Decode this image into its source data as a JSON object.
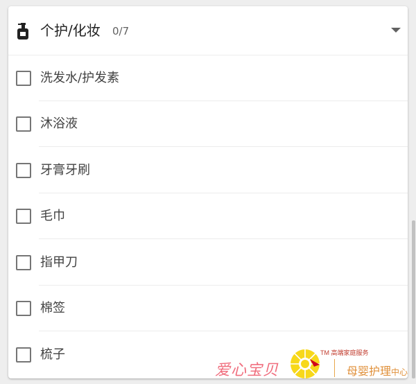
{
  "category": {
    "icon": "lotion-bottle-icon",
    "title": "个护/化妆",
    "count": "0/7",
    "expand_icon": "chevron-down-icon"
  },
  "items": [
    {
      "label": "洗发水/护发素",
      "checked": false
    },
    {
      "label": "沐浴液",
      "checked": false
    },
    {
      "label": "牙膏牙刷",
      "checked": false
    },
    {
      "label": "毛巾",
      "checked": false
    },
    {
      "label": "指甲刀",
      "checked": false
    },
    {
      "label": "棉签",
      "checked": false
    },
    {
      "label": "梳子",
      "checked": false
    }
  ],
  "watermark": {
    "left_text": "爱心宝贝",
    "tm_text": "TM 高端家庭服务",
    "right_text_main": "母婴护理",
    "right_text_small": "中心"
  },
  "colors": {
    "checkbox_border": "#757575",
    "title_text": "#212121",
    "item_text": "#424242",
    "watermark_pink": "#f06e7e",
    "watermark_orange": "#e0903a"
  }
}
